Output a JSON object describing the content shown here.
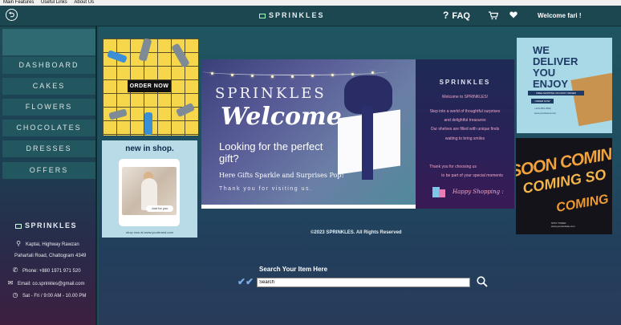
{
  "menubar": {
    "items": [
      "Main Features",
      "Useful Links",
      "About Us"
    ]
  },
  "header": {
    "brand": "SPRINKLES",
    "faq_mark": "?",
    "faq_label": "FAQ",
    "cart_icon": "cart-icon",
    "heart_icon": "heart-icon",
    "welcome": "Welcome fari !"
  },
  "sidebar": {
    "items": [
      {
        "label": "DASHBOARD"
      },
      {
        "label": "CAKES"
      },
      {
        "label": "FLOWERS"
      },
      {
        "label": "CHOCOLATES"
      },
      {
        "label": "DRESSES"
      },
      {
        "label": "OFFERS"
      }
    ],
    "brand": "SPRINKLES",
    "address_line1": "Kaptai, Highway Rawzan",
    "address_line2": "Pahartali Road, Chattogram 4349",
    "phone": "Phone: +880 1971 971 520",
    "email": "Email: co.sprinkles@gmail.com",
    "hours": "Sat - Fri / 9:00 AM - 10.00 PM"
  },
  "promo_order": {
    "button": "ORDER NOW"
  },
  "promo_shop": {
    "title": "new in shop.",
    "tag": "Just for you",
    "footer": "shop now at www.yourbrand.com"
  },
  "banner": {
    "title_top": "SPRINKLES",
    "title_script": "Welcome",
    "headline": "Looking for the perfect gift?",
    "subline": "Here Gifts Sparkle and Surprises Pop!",
    "thanks": "Thank you for visiting us."
  },
  "welcome_card": {
    "title": "SPRINKLES",
    "line1": "Welcome to SPRINKLES!",
    "line2": "Step into a world of thoughtful surprises",
    "line3": "and delightful treasures",
    "line4": "Our shelves are filled with unique finds",
    "line5": "waiting to bring smiles",
    "line6": "Thank you for choosing us",
    "line7": "to be part of your special moments",
    "happy": "Happy Shopping :"
  },
  "promo_deliver": {
    "text": "WE DELIVER YOU ENJOY",
    "strip": "FREE SHIPPING ON FIRST ORDER",
    "button": "ORDER NOW",
    "phone": "+123-456-7890",
    "site": "www.yourbrand.com"
  },
  "promo_soon": {
    "line1": "SOON COMING SOO",
    "line2": "COMING SO",
    "line3": "COMING S",
    "foot1": "STAY TUNED",
    "foot2": "www.yourwebsite.com"
  },
  "footer": {
    "copyright": "©2023 SPRINKLES. All Rights Reserved"
  },
  "search": {
    "label": "Search Your Item Here",
    "value": "Search"
  },
  "colors": {
    "topbar": "#1c4650",
    "sidebar_item": "#235760",
    "promo_yellow": "#f6d64a",
    "welcome_pink": "#f2a9c6"
  }
}
